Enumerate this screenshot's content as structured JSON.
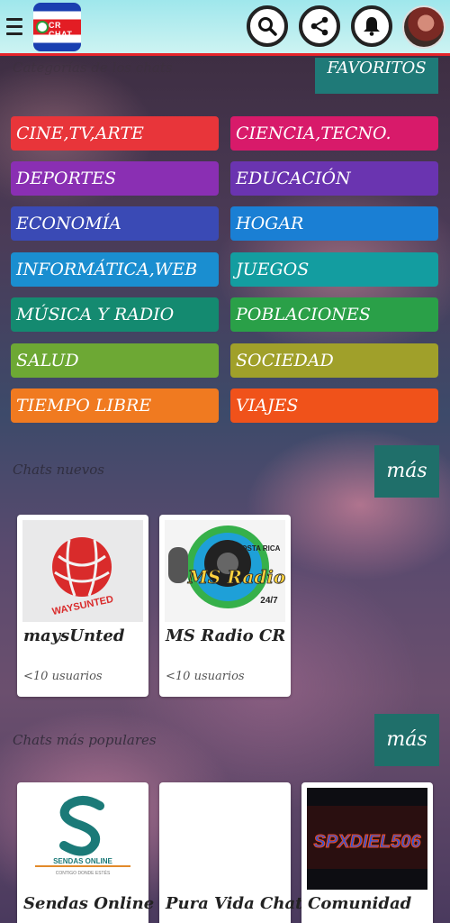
{
  "header": {
    "logo_text": "CR CHAT",
    "icons": [
      "menu-icon",
      "search-icon",
      "share-icon",
      "bell-icon",
      "avatar"
    ]
  },
  "categories_section": {
    "faded_title": "Categorías de los chats",
    "favorites_label": "FAVORITOS",
    "items": [
      {
        "label": "CINE,TV,ARTE",
        "color": "#e8353a"
      },
      {
        "label": "CIENCIA,TECNO.",
        "color": "#d81a6a"
      },
      {
        "label": "DEPORTES",
        "color": "#8a2fb3"
      },
      {
        "label": "EDUCACIÓN",
        "color": "#6a34b0"
      },
      {
        "label": "ECONOMÍA",
        "color": "#3a4ab5"
      },
      {
        "label": "HOGAR",
        "color": "#1a7fd4"
      },
      {
        "label": "INFORMÁTICA,WEB",
        "color": "#1a8ed0"
      },
      {
        "label": "JUEGOS",
        "color": "#139da0"
      },
      {
        "label": "MÚSICA Y RADIO",
        "color": "#148a70"
      },
      {
        "label": "POBLACIONES",
        "color": "#2aa048"
      },
      {
        "label": "SALUD",
        "color": "#6da834"
      },
      {
        "label": "SOCIEDAD",
        "color": "#a0a02a"
      },
      {
        "label": "TIEMPO LIBRE",
        "color": "#f07a20"
      },
      {
        "label": "VIAJES",
        "color": "#f0521a"
      }
    ]
  },
  "new_chats": {
    "title": "Chats nuevos",
    "more_label": "más",
    "cards": [
      {
        "name": "maysUnted",
        "users": "<10 usuarios",
        "logo_text": "WAYSUNTED"
      },
      {
        "name": "MS Radio CR",
        "users": "<10 usuarios",
        "logo_text": "MS Radio",
        "logo_sub": "COSTA RICA",
        "logo_badge": "24/7"
      }
    ]
  },
  "popular_chats": {
    "title": "Chats más populares",
    "more_label": "más",
    "cards": [
      {
        "name": "Sendas Online",
        "logo_text": "SENDAS ONLINE",
        "logo_sub": "CONTIGO DONDE ESTÉS"
      },
      {
        "name": "Pura Vida Chat"
      },
      {
        "name": "Comunidad",
        "logo_text": "SPXDIEL506"
      }
    ]
  }
}
